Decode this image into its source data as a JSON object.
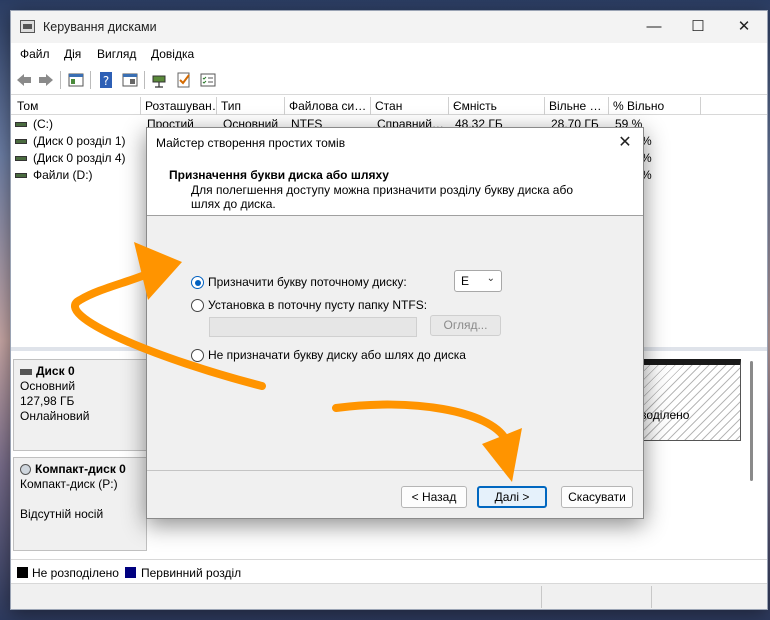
{
  "window": {
    "title": "Керування дисками",
    "controls": [
      "—",
      "☐",
      "✕"
    ]
  },
  "menu": [
    "Файл",
    "Дія",
    "Вигляд",
    "Довідка"
  ],
  "toolbar_icons": [
    "back-icon",
    "forward-icon",
    "properties-icon",
    "help-icon",
    "show-hide-icon",
    "connect-icon",
    "check-icon",
    "list-icon"
  ],
  "columns": [
    "Том",
    "Розташуван…",
    "Тип",
    "Файлова си…",
    "Стан",
    "Ємність",
    "Вільне …",
    "% Вільно"
  ],
  "volumes": [
    {
      "name": "(C:)",
      "layout": "Простий",
      "type": "Основний",
      "fs": "NTFS",
      "status": "Справний…",
      "capacity": "48,32 ГБ",
      "free": "28,70 ГБ",
      "pct": "59 %"
    },
    {
      "name": "(Диск 0 розділ 1)",
      "pct": "%"
    },
    {
      "name": "(Диск 0 розділ 4)",
      "pct": "%"
    },
    {
      "name": "Файли (D:)",
      "pct": "%"
    }
  ],
  "disks": [
    {
      "title": "Диск 0",
      "line1": "Основний",
      "line2": "127,98 ГБ",
      "line3": "Онлайновий"
    },
    {
      "title": "Компакт-диск 0",
      "line1": "Компакт-диск (P:)",
      "line2": "",
      "line3": "Відсутній носій"
    }
  ],
  "partition_text": "зоділено",
  "legend": {
    "unallocated": "Не розподілено",
    "primary": "Первинний розділ",
    "unallocated_color": "#000000",
    "primary_color": "#00007f"
  },
  "dialog": {
    "title": "Майстер створення простих томів",
    "heading": "Призначення букви диска або шляху",
    "description": "Для полегшення доступу можна призначити розділу букву диска або шлях до диска.",
    "option_letter": "Призначити букву поточному диску:",
    "selected_letter": "E",
    "option_folder": "Установка в поточну пусту папку NTFS:",
    "browse": "Огляд...",
    "option_none": "Не призначати букву диску або шлях до диска",
    "back": "< Назад",
    "next": "Далі >",
    "cancel": "Скасувати"
  },
  "accent_color": "#ff9400"
}
